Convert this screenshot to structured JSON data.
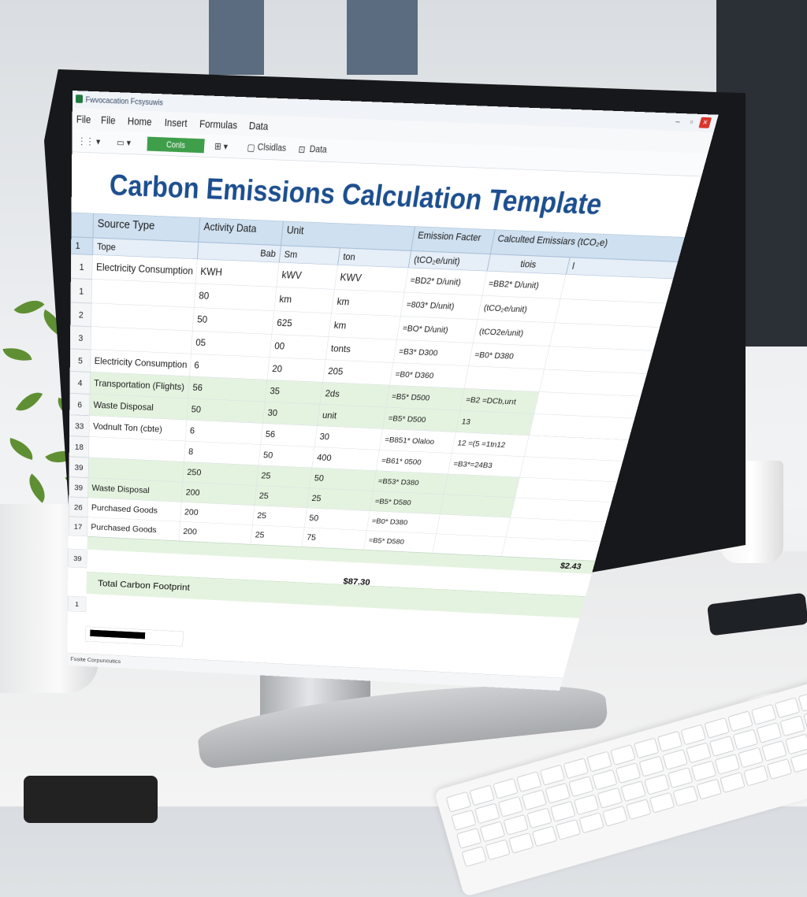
{
  "app": {
    "window_title": "Fwvocacation Fcsysuwis",
    "menus": [
      "File",
      "File",
      "Home",
      "Insert",
      "Formulas",
      "Data"
    ],
    "toolbar_button": "Conls",
    "toolbar_items": [
      "Clsidlas",
      "Data"
    ],
    "accent_green": "#3e9e4a",
    "heading_color": "#1d4f8f"
  },
  "sheet": {
    "heading": "Carbon Emissions Calculation Template",
    "headers": {
      "source_type": "Source Type",
      "activity_data": "Activity Data",
      "unit": "Unit",
      "emission_factor": "Emission Facter",
      "calculated": "Calculted Emissiars (tCO₂e)"
    },
    "subheaders": {
      "type": "Tope",
      "bab": "Bab",
      "sm": "Sm",
      "ton": "ton",
      "factor_unit": "(tCO₂e/unit)",
      "tois": "tiois",
      "small": "l"
    },
    "rows": [
      {
        "num": "1",
        "source": "Electricity Consumption",
        "a": "KWH",
        "b": "kWV",
        "c": "KWV",
        "factor": "=BD2* D/unit)",
        "calc": "=BB2* D/unit)",
        "green": false
      },
      {
        "num": "1",
        "source": "",
        "a": "80",
        "b": "km",
        "c": "km",
        "factor": "=803* D/unit)",
        "calc": "(tCO₂e/unit)",
        "green": false
      },
      {
        "num": "2",
        "source": "",
        "a": "50",
        "b": "625",
        "c": "km",
        "factor": "=BO* D/unit)",
        "calc": "(tCO2e/unit)",
        "green": false
      },
      {
        "num": "3",
        "source": "",
        "a": "05",
        "b": "00",
        "c": "tonts",
        "factor": "=B3* D300",
        "calc": "=B0* D380",
        "green": false
      },
      {
        "num": "5",
        "source": "Electricity Consumption",
        "a": "6",
        "b": "20",
        "c": "205",
        "factor": "=B0* D360",
        "calc": "",
        "green": false
      },
      {
        "num": "4",
        "source": "Transportation (Flights)",
        "a": "56",
        "b": "35",
        "c": "2ds",
        "factor": "=B5* D500",
        "calc": "=B2 =DCb,urıt",
        "green": true
      },
      {
        "num": "6",
        "source": "Waste Disposal",
        "a": "50",
        "b": "30",
        "c": "unit",
        "factor": "=B5* D500",
        "calc": "13",
        "green": true
      },
      {
        "num": "33",
        "source": "Vodnult Ton (cbte)",
        "a": "6",
        "b": "56",
        "c": "30",
        "factor": "=B851* Olaloo",
        "calc": "12 =(5 =1tn12",
        "green": false
      },
      {
        "num": "18",
        "source": "",
        "a": "8",
        "b": "50",
        "c": "400",
        "factor": "=B61* 0500",
        "calc": "=B3*=24B3",
        "green": false
      },
      {
        "num": "39",
        "source": "",
        "a": "250",
        "b": "25",
        "c": "50",
        "factor": "=B53* D380",
        "calc": "",
        "green": true
      },
      {
        "num": "39",
        "source": "Waste Disposal",
        "a": "200",
        "b": "25",
        "c": "25",
        "factor": "=B5* D580",
        "calc": "",
        "green": true
      },
      {
        "num": "26",
        "source": "Purchased Goods",
        "a": "200",
        "b": "25",
        "c": "50",
        "factor": "=B0* D380",
        "calc": "",
        "green": false
      },
      {
        "num": "17",
        "source": "Purchased Goods",
        "a": "200",
        "b": "25",
        "c": "75",
        "factor": "=B5* D580",
        "calc": "",
        "green": false
      }
    ],
    "extra_rows": [
      "39",
      "1"
    ],
    "sum_value": "$2.43",
    "total_label": "Total Carbon Footprint",
    "total_value": "$87.30"
  },
  "status": {
    "text": "Fssite Corpuncutics"
  }
}
